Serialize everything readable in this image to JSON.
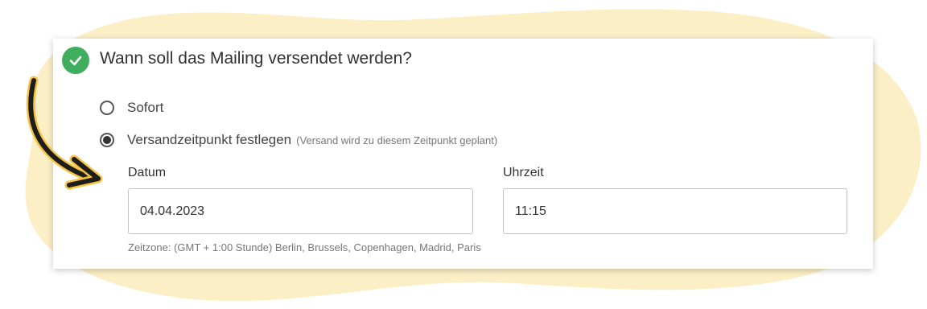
{
  "question": {
    "title": "Wann soll das Mailing versendet werden?",
    "status_icon": "check-circle-icon"
  },
  "options": [
    {
      "label": "Sofort",
      "hint": "",
      "selected": false
    },
    {
      "label": "Versandzeitpunkt festlegen",
      "hint": "(Versand wird zu diesem Zeitpunkt geplant)",
      "selected": true
    }
  ],
  "schedule": {
    "date_label": "Datum",
    "date_value": "04.04.2023",
    "time_label": "Uhrzeit",
    "time_value": "11:15",
    "timezone_note": "Zeitzone: (GMT + 1:00 Stunde) Berlin, Brussels, Copenhagen, Madrid, Paris"
  },
  "colors": {
    "accent_green": "#3fae5f",
    "background_blob": "#fcefc6",
    "arrow": "#1d1d1b",
    "arrow_head": "#f6c343"
  }
}
